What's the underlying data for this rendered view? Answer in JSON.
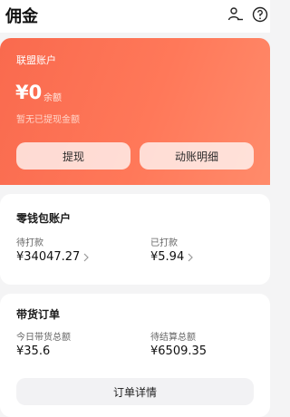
{
  "header": {
    "title": "佣金",
    "icons": [
      "user-settings-icon",
      "help-icon"
    ]
  },
  "alliance": {
    "label": "联盟账户",
    "amount": "¥0",
    "amount_sub": "余额",
    "note": "暂无已提现金额",
    "withdraw_label": "提现",
    "statement_label": "动账明细"
  },
  "wallet": {
    "title": "零钱包账户",
    "pending_label": "待打款",
    "pending_value": "¥34047.27",
    "paid_label": "已打款",
    "paid_value": "¥5.94"
  },
  "orders": {
    "title": "带货订单",
    "today_label": "今日带货总额",
    "today_value": "¥35.6",
    "settle_label": "待结算总额",
    "settle_value": "¥6509.35",
    "detail_button": "订单详情"
  },
  "colors": {
    "accent_start": "#f96a4e",
    "accent_end": "#ff8b6b",
    "page_bg": "#f4f4f5"
  }
}
